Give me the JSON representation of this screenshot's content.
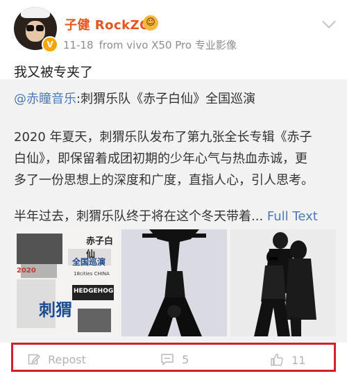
{
  "header": {
    "username": "子健 RockZO",
    "time": "11-18",
    "source": "from vivo X50 Pro 专业影像",
    "avatar_icon": "avatar-sunglasses",
    "verified_icon": "verified-badge",
    "badge_icon": "emoji-badge"
  },
  "post": {
    "text": "我又被专夹了"
  },
  "repost": {
    "mention": "@赤瞳音乐",
    "title": ":刺猬乐队《赤子白仙》全国巡演",
    "lines": [
      "2020 年夏天，刺猬乐队发布了第九张全长专辑《赤子",
      "白仙》，即保留着成团初期的少年心气与热血赤诚，更",
      "多了一份思想上的深度和广度，直指人心，引人思考。"
    ],
    "last_line": "半年过去，刺猬乐队终于将在这个冬天带着...",
    "full_text_label": "Full Text"
  },
  "poster": {
    "top_text": "赤子白仙",
    "tour_label": "全国巡演",
    "band_label": "HEDGEHOG",
    "cn_band": "刺猬",
    "year": "2020",
    "cities": "18cities CHINA"
  },
  "actions": {
    "repost_label": "Repost",
    "comment_count": "5",
    "like_count": "11",
    "repost_icon": "edit-icon",
    "comment_icon": "comment-icon",
    "like_icon": "thumbs-up-icon"
  },
  "colors": {
    "username": "#e8541f",
    "link": "#4c79b6",
    "highlight_border": "#d2212a",
    "action_gray": "#b3b3b3"
  }
}
